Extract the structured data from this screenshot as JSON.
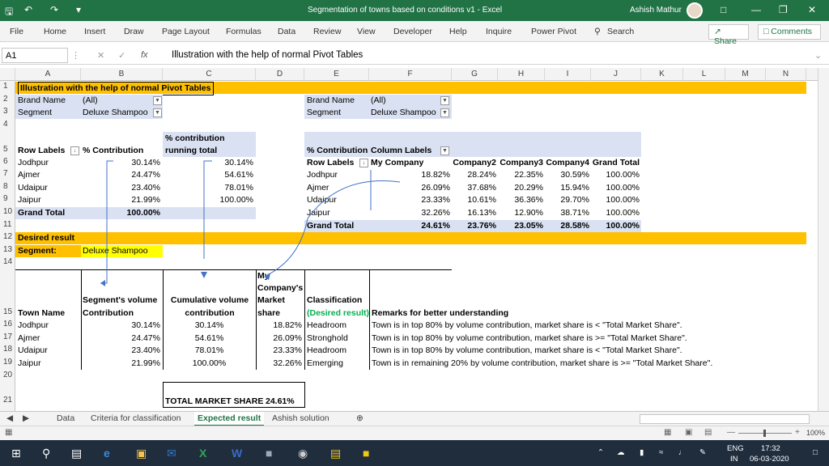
{
  "window": {
    "title": "Segmentation of towns based on conditions v1  -  Excel",
    "user": "Ashish Mathur"
  },
  "ribbon": {
    "tabs": [
      "File",
      "Home",
      "Insert",
      "Draw",
      "Page Layout",
      "Formulas",
      "Data",
      "Review",
      "View",
      "Developer",
      "Help",
      "Inquire",
      "Power Pivot"
    ],
    "search": "Search",
    "share": "Share",
    "comments": "Comments"
  },
  "formula_bar": {
    "name_box": "A1",
    "fx": "fx",
    "content": "Illustration with the help of normal Pivot Tables"
  },
  "columns": [
    "A",
    "B",
    "C",
    "D",
    "E",
    "F",
    "G",
    "H",
    "I",
    "J",
    "K",
    "L",
    "M",
    "N"
  ],
  "rows": [
    "1",
    "2",
    "3",
    "4",
    "5",
    "6",
    "7",
    "8",
    "9",
    "10",
    "11",
    "12",
    "13",
    "14",
    "15",
    "16",
    "17",
    "18",
    "19",
    "20",
    "21"
  ],
  "cells": {
    "title": "Illustration with the help of normal Pivot Tables",
    "brand_name": "Brand Name",
    "all": "(All)",
    "segment": "Segment",
    "deluxe": "Deluxe Shampoo",
    "pct_contrib_run_1": "% contribution",
    "pct_contrib_run_2": "running total",
    "row_labels": "Row Labels",
    "pct_contribution": "% Contribution",
    "towns": [
      "Jodhpur",
      "Ajmer",
      "Udaipur",
      "Jaipur"
    ],
    "pt1_contrib": [
      "30.14%",
      "24.47%",
      "23.40%",
      "21.99%"
    ],
    "pt1_running": [
      "30.14%",
      "54.61%",
      "78.01%",
      "100.00%"
    ],
    "grand_total": "Grand Total",
    "pt1_total": "100.00%",
    "pt2_pct": "% Contribution",
    "pt2_col_labels": "Column Labels",
    "pt2_row_labels": "Row Labels",
    "pt2_companies": [
      "My Company",
      "Company2",
      "Company3",
      "Company4",
      "Grand Total"
    ],
    "pt2_rows": [
      [
        "18.82%",
        "28.24%",
        "22.35%",
        "30.59%",
        "100.00%"
      ],
      [
        "26.09%",
        "37.68%",
        "20.29%",
        "15.94%",
        "100.00%"
      ],
      [
        "23.33%",
        "10.61%",
        "36.36%",
        "29.70%",
        "100.00%"
      ],
      [
        "32.26%",
        "16.13%",
        "12.90%",
        "38.71%",
        "100.00%"
      ]
    ],
    "pt2_totals": [
      "24.61%",
      "23.76%",
      "23.05%",
      "28.58%",
      "100.00%"
    ],
    "desired_result": "Desired result",
    "segment_label": "Segment:",
    "h_town": "Town Name",
    "h_vol_1": "Segment's volume",
    "h_vol_2": "Contribution",
    "h_cum_1": "Cumulative volume",
    "h_cum_2": "contribution",
    "h_my_1": "My",
    "h_my_2": "Company's",
    "h_my_3": "Market",
    "h_my_4": "share",
    "h_class_1": "Classification",
    "h_class_2": "(Desired result)",
    "h_remarks": "Remarks for better understanding",
    "result_vol": [
      "30.14%",
      "24.47%",
      "23.40%",
      "21.99%"
    ],
    "result_cum": [
      "30.14%",
      "54.61%",
      "78.01%",
      "100.00%"
    ],
    "result_share": [
      "18.82%",
      "26.09%",
      "23.33%",
      "32.26%"
    ],
    "result_class": [
      "Headroom",
      "Stronghold",
      "Headroom",
      "Emerging"
    ],
    "result_remarks": [
      "Town is in top 80% by volume contribution, market share is < \"Total Market Share\".",
      "Town is in top 80% by volume contribution, market share is >= \"Total Market Share\".",
      "Town is in top 80% by volume contribution, market share is < \"Total Market Share\".",
      "Town is in remaining 20% by volume contribution, market share is >= \"Total Market Share\"."
    ],
    "tms_label": "TOTAL MARKET SHARE",
    "tms_value": "24.61%"
  },
  "sheets": [
    "Data",
    "Criteria for classification",
    "Expected result",
    "Ashish solution"
  ],
  "status": {
    "zoom": "100%"
  },
  "taskbar": {
    "lang1": "ENG",
    "lang2": "IN",
    "time": "17:32",
    "date": "06-03-2020"
  },
  "colors": {
    "excel_green": "#217346",
    "orange": "#ffc000",
    "pivot_blue": "#d9e1f2",
    "yellow": "#ffff00"
  }
}
